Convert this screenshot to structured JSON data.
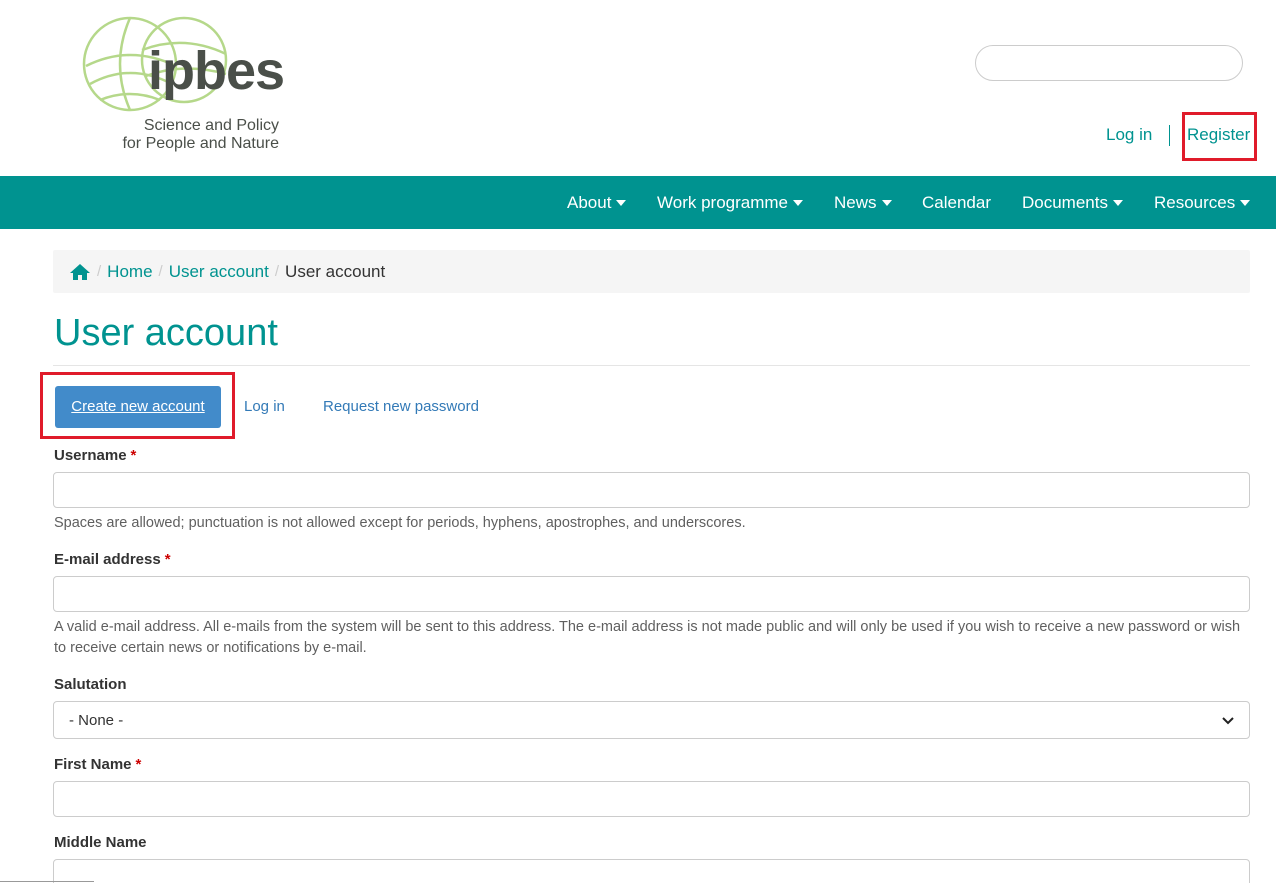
{
  "header": {
    "logo_word": "ipbes",
    "logo_tagline_1": "Science and Policy",
    "logo_tagline_2": "for People and Nature",
    "search_placeholder": "",
    "login_label": "Log in",
    "register_label": "Register"
  },
  "nav": {
    "items": [
      {
        "label": "About",
        "has_caret": true
      },
      {
        "label": "Work programme",
        "has_caret": true
      },
      {
        "label": "News",
        "has_caret": true
      },
      {
        "label": "Calendar",
        "has_caret": false
      },
      {
        "label": "Documents",
        "has_caret": true
      },
      {
        "label": "Resources",
        "has_caret": true
      }
    ]
  },
  "breadcrumb": {
    "home_icon": "home-icon",
    "items": [
      "Home",
      "User account"
    ],
    "current": "User account"
  },
  "page": {
    "title": "User account"
  },
  "tabs": {
    "active": "Create new account",
    "login": "Log in",
    "request_password": "Request new password"
  },
  "form": {
    "username": {
      "label": "Username",
      "required_mark": "*",
      "value": "",
      "help": "Spaces are allowed; punctuation is not allowed except for periods, hyphens, apostrophes, and underscores."
    },
    "email": {
      "label": "E-mail address",
      "required_mark": "*",
      "value": "",
      "help": "A valid e-mail address. All e-mails from the system will be sent to this address. The e-mail address is not made public and will only be used if you wish to receive a new password or wish to receive certain news or notifications by e-mail."
    },
    "salutation": {
      "label": "Salutation",
      "selected": "- None -"
    },
    "first_name": {
      "label": "First Name",
      "required_mark": "*",
      "value": ""
    },
    "middle_name": {
      "label": "Middle Name",
      "value": ""
    }
  },
  "colors": {
    "brand_teal": "#009390",
    "button_blue": "#428bca",
    "highlight_red": "#e01b2a",
    "required_red": "#cc0000"
  }
}
